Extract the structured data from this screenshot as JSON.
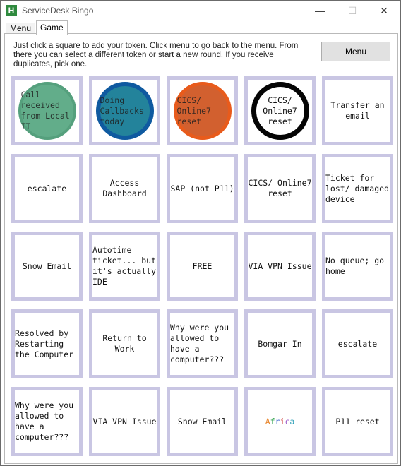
{
  "window": {
    "title": "ServiceDesk Bingo",
    "icon": "H"
  },
  "controls": {
    "minimize": "—",
    "maximize": "☐",
    "close": "✕"
  },
  "tabs": [
    {
      "label": "Menu"
    },
    {
      "label": "Game"
    }
  ],
  "instructions": "Just click a square to add your token. Click menu to go back to the menu. From there you can select a different token or start a new round. If you receive duplicates, pick one.",
  "menu_button": "Menu",
  "board": [
    [
      "Call received from Local IT",
      "Doing Callbacks today",
      "CICS/ Online7 reset",
      "CICS/ Online7 reset",
      "Transfer an email"
    ],
    [
      "escalate",
      "Access Dashboard",
      "SAP (not P11)",
      "CICS/ Online7 reset",
      "Ticket for lost/ damaged device"
    ],
    [
      "Snow Email",
      "Autotime ticket... but it's actually IDE",
      "FREE",
      "VIA VPN Issue",
      "No queue; go home"
    ],
    [
      "Resolved by Restarting the Computer",
      "Return to Work",
      "Why were you allowed to have a computer???",
      "Bomgar In",
      "escalate"
    ],
    [
      "Why were you allowed to have a computer???",
      "VIA VPN Issue",
      "Snow Email",
      "Africa",
      "P11 reset"
    ]
  ],
  "tokens": {
    "r0c0": {
      "color": "#62ad8a",
      "ring": "#55a07d"
    },
    "r0c1": {
      "color": "#23839b",
      "ring": "#0f5aa0"
    },
    "r0c2": {
      "color": "#d2602f",
      "ring": "#e85b1c"
    },
    "r0c3": {
      "color": "#ffffff",
      "ring": "#050505"
    }
  },
  "africa_letter_colors": [
    "#e8862e",
    "#3aa655",
    "#4a6fd0",
    "#d24a4a",
    "#9a55c8",
    "#2fa0b8"
  ]
}
